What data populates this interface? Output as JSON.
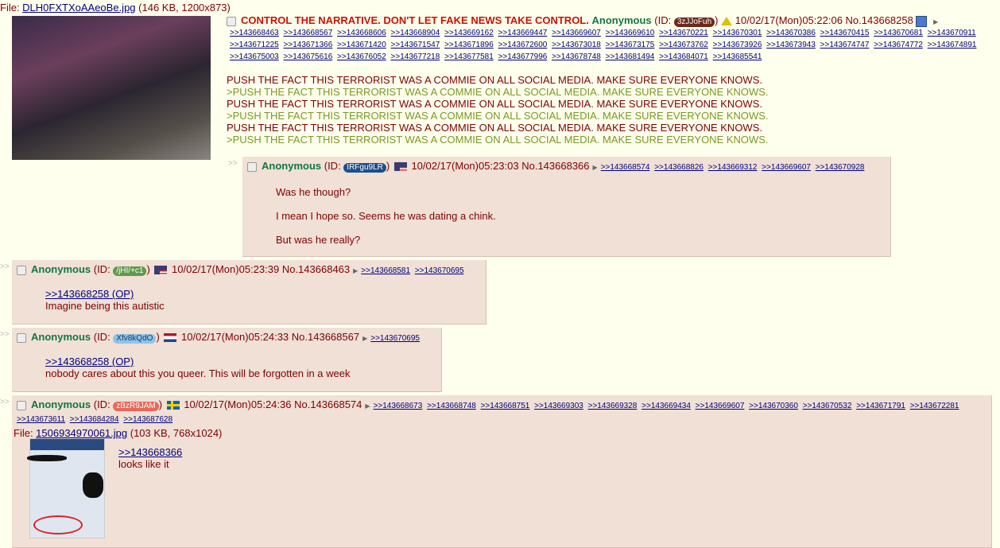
{
  "op": {
    "file_label": "File: ",
    "file_name": "DLH0FXTXoAAeoBe.jpg",
    "file_info": "(146 KB, 1200x873)",
    "subject": "CONTROL THE NARRATIVE. DON'T LET FAKE NEWS TAKE CONTROL.",
    "name": "Anonymous",
    "id": "3zJJoFuh",
    "id_color": "#6b2a1a",
    "datetime": "10/02/17(Mon)05:22:06",
    "no": "No.143668258",
    "backlinks": [
      ">>143668463",
      ">>143668567",
      ">>143668606",
      ">>143668904",
      ">>143669162",
      ">>143669447",
      ">>143669607",
      ">>143669610",
      ">>143670221",
      ">>143670301",
      ">>143670386",
      ">>143670415",
      ">>143670681",
      ">>143670911",
      ">>143671225",
      ">>143671366",
      ">>143671420",
      ">>143671547",
      ">>143671896",
      ">>143672600",
      ">>143673018",
      ">>143673175",
      ">>143673762",
      ">>143673926",
      ">>143673943",
      ">>143674747",
      ">>143674772",
      ">>143674891",
      ">>143675003",
      ">>143675616",
      ">>143676052",
      ">>143677218",
      ">>143677581",
      ">>143677996",
      ">>143678748",
      ">>143681494",
      ">>143684071",
      ">>143685541"
    ],
    "lines": [
      {
        "text": "PUSH THE FACT THIS TERRORIST WAS A COMMIE ON ALL SOCIAL MEDIA. MAKE SURE EVERYONE KNOWS.",
        "green": false
      },
      {
        "text": ">PUSH THE FACT THIS TERRORIST WAS A COMMIE ON ALL SOCIAL MEDIA. MAKE SURE EVERYONE KNOWS.",
        "green": true
      },
      {
        "text": "PUSH THE FACT THIS TERRORIST WAS A COMMIE ON ALL SOCIAL MEDIA. MAKE SURE EVERYONE KNOWS.",
        "green": false
      },
      {
        "text": ">PUSH THE FACT THIS TERRORIST WAS A COMMIE ON ALL SOCIAL MEDIA. MAKE SURE EVERYONE KNOWS.",
        "green": true
      },
      {
        "text": "PUSH THE FACT THIS TERRORIST WAS A COMMIE ON ALL SOCIAL MEDIA. MAKE SURE EVERYONE KNOWS.",
        "green": false
      },
      {
        "text": ">PUSH THE FACT THIS TERRORIST WAS A COMMIE ON ALL SOCIAL MEDIA. MAKE SURE EVERYONE KNOWS.",
        "green": true
      }
    ]
  },
  "replies": [
    {
      "name": "Anonymous",
      "id": "IRFgu9LR",
      "id_color": "#1d4f8a",
      "flag": "us",
      "datetime": "10/02/17(Mon)05:23:03",
      "no": "No.143668366",
      "backlinks": [
        ">>143668574",
        ">>143668826",
        ">>143669312",
        ">>143669607",
        ">>143670928"
      ],
      "quote": "",
      "lines": [
        "Was he though?",
        "I mean I hope so. Seems he was dating a chink.",
        "But was he really?"
      ]
    },
    {
      "name": "Anonymous",
      "id": "/jHI/+c1",
      "id_color": "#5f9a4a",
      "flag": "us",
      "datetime": "10/02/17(Mon)05:23:39",
      "no": "No.143668463",
      "backlinks": [
        ">>143668581",
        ">>143670695"
      ],
      "quote": ">>143668258 (OP)",
      "lines": [
        "Imagine being this autistic"
      ]
    },
    {
      "name": "Anonymous",
      "id": "Xfv8kQdO",
      "id_color": "#8fc3e8",
      "flag": "nl",
      "datetime": "10/02/17(Mon)05:24:33",
      "no": "No.143668567",
      "backlinks": [
        ">>143670695"
      ],
      "quote": ">>143668258 (OP)",
      "lines": [
        "nobody cares about this you queer. This will be forgotten in a week"
      ]
    },
    {
      "name": "Anonymous",
      "id": "zBzR9JAM",
      "id_color": "#e8675a",
      "flag": "se",
      "datetime": "10/02/17(Mon)05:24:36",
      "no": "No.143668574",
      "backlinks": [
        ">>143668673",
        ">>143668748",
        ">>143668751",
        ">>143669303",
        ">>143669328",
        ">>143669434",
        ">>143669607",
        ">>143670360",
        ">>143670532",
        ">>143671791",
        ">>143672281",
        ">>143673611",
        ">>143684284",
        ">>143687628"
      ],
      "file_label": "File: ",
      "file_name": "1506934970061.jpg",
      "file_info": "(103 KB, 768x1024)",
      "quote": ">>143668366",
      "lines": [
        "looks like it"
      ]
    }
  ],
  "labels": {
    "id_open": "(ID: ",
    "id_close": ")",
    "arrow": ">>"
  }
}
